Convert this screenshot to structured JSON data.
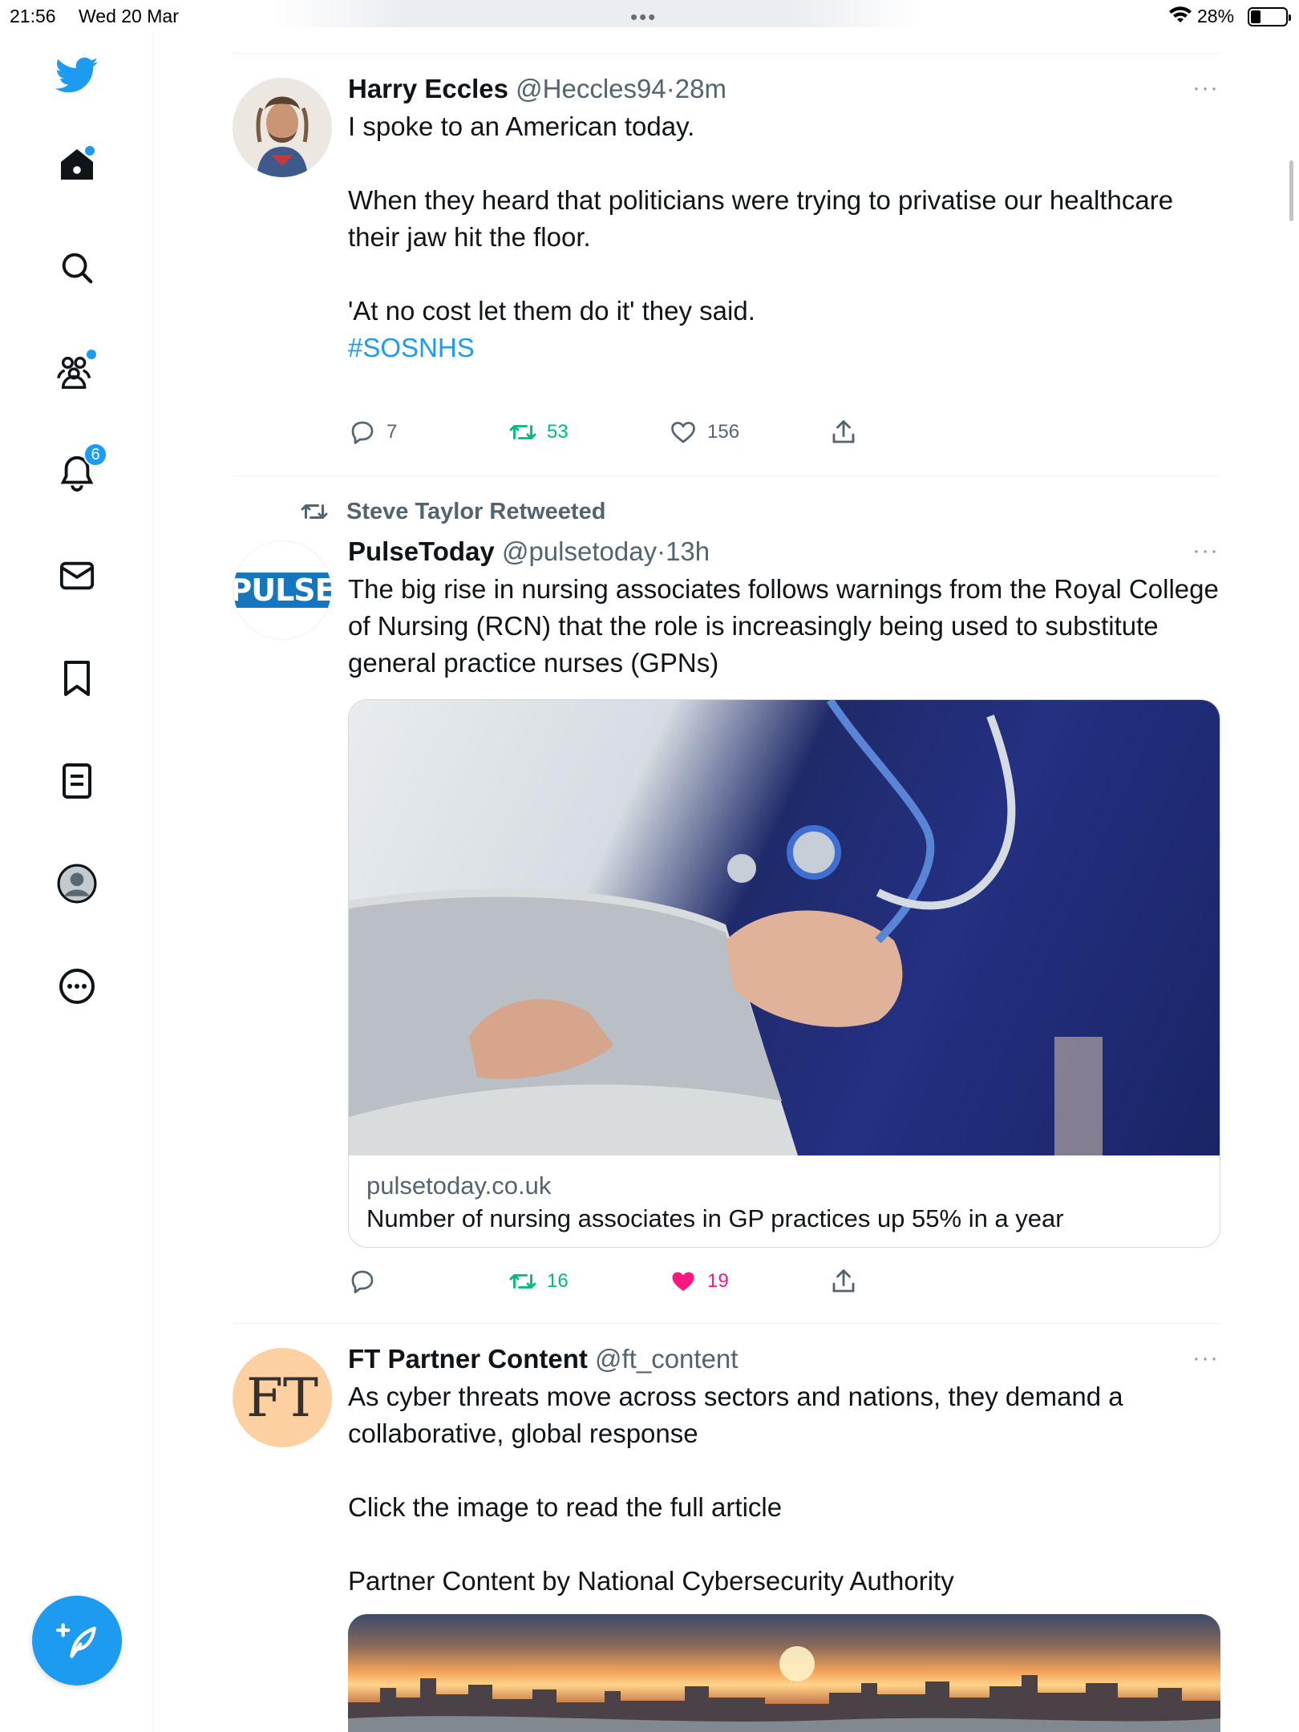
{
  "status_bar": {
    "time": "21:56",
    "date": "Wed 20 Mar",
    "battery": "28%",
    "battery_level": 0.28
  },
  "sidebar": {
    "items": [
      {
        "name": "home",
        "has_dot": true
      },
      {
        "name": "explore"
      },
      {
        "name": "communities",
        "has_dot": true
      },
      {
        "name": "notifications",
        "badge": "6"
      },
      {
        "name": "messages"
      },
      {
        "name": "bookmarks"
      },
      {
        "name": "lists"
      },
      {
        "name": "profile"
      },
      {
        "name": "more"
      }
    ],
    "accent": "#1d9bf0"
  },
  "tweets": [
    {
      "name": "Harry Eccles",
      "handle": "@Heccles94",
      "sep": "·",
      "time": "28m",
      "text": "I spoke to an American today.\n\nWhen they heard that politicians were trying to privatise our healthcare their jaw hit the floor.\n\n'At no cost let them do it' they said.\n",
      "hashtag": "#SOSNHS",
      "replies": "7",
      "retweets": "53",
      "likes": "156"
    },
    {
      "context": "Steve Taylor Retweeted",
      "name": "PulseToday",
      "handle": "@pulsetoday",
      "sep": "·",
      "time": "13h",
      "avatar_text": "PULSE",
      "text": "The big rise in nursing associates follows warnings from the Royal College of Nursing (RCN) that the role is increasingly being used to substitute general practice nurses (GPNs)",
      "card_domain": "pulsetoday.co.uk",
      "card_title": "Number of nursing associates in GP practices up 55% in a year",
      "retweets": "16",
      "likes": "19"
    },
    {
      "name": "FT Partner Content",
      "handle": "@ft_content",
      "avatar_text": "FT",
      "text": "As cyber threats move across sectors and nations, they demand a collaborative, global response\n\nClick the image to read the full article\n\nPartner Content by National Cybersecurity Authority"
    }
  ],
  "more_glyph": "···"
}
